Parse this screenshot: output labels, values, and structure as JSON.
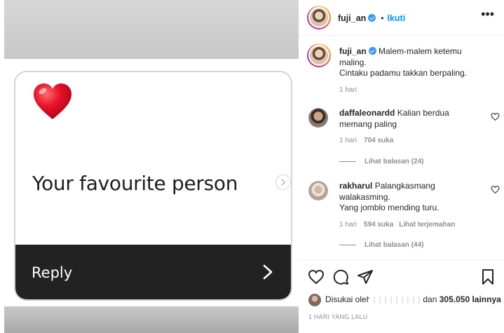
{
  "story": {
    "caption_text": "Your favourite person",
    "reply_label": "Reply"
  },
  "post": {
    "author": "fuji_an",
    "follow_label": "Ikuti",
    "dot": "•",
    "more_label": "•••"
  },
  "caption": {
    "author": "fuji_an",
    "line1": "Malem-malem ketemu maling.",
    "line2": "Cintaku padamu takkan berpaling.",
    "time": "1 hari"
  },
  "comments": [
    {
      "author": "daffaleonardd",
      "text": "Kalian berdua memang paling",
      "time": "1 hari",
      "likes": "704 suka",
      "replies": "Lihat balasan (24)"
    },
    {
      "author": "rakharul",
      "text": "Palangkasmang walakasming.",
      "text2": "Yang jomblo mending turu.",
      "time": "1 hari",
      "likes": "594 suka",
      "translate": "Lihat terjemahan",
      "replies": "Lihat balasan (44)"
    }
  ],
  "likes": {
    "prefix": "Disukai oleh",
    "suffix": "dan",
    "count": "305.050 lainnya"
  },
  "time_ago": "1 HARI YANG LALU",
  "colors": {
    "accent": "#0095f6",
    "verified": "#3897f0",
    "heart": "#e0112b",
    "reply_bar": "#222222",
    "muted": "#8e8e8e"
  },
  "icons": [
    "heart-emoji-icon",
    "chevron-right-icon",
    "verified-icon",
    "more-icon",
    "like-icon",
    "comment-icon",
    "share-icon",
    "save-icon"
  ]
}
